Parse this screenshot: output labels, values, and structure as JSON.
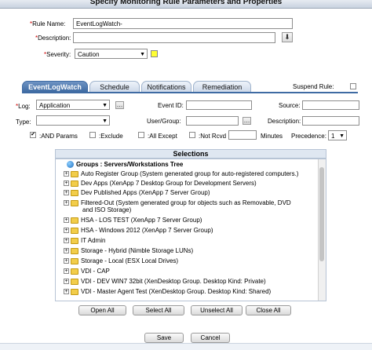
{
  "window": {
    "title": "Specify Monitoring Rule Parameters and Properties"
  },
  "form": {
    "rule_name": {
      "label": "Rule Name:",
      "value": "EventLogWatch-"
    },
    "description": {
      "label": "Description:",
      "value": ""
    },
    "severity": {
      "label": "Severity:",
      "value": "Caution",
      "color": "#ffff33"
    }
  },
  "tabs": [
    {
      "label": "EventLogWatch",
      "active": true
    },
    {
      "label": "Schedule",
      "active": false
    },
    {
      "label": "Notifications",
      "active": false
    },
    {
      "label": "Remediation",
      "active": false
    }
  ],
  "suspend_rule": {
    "label": "Suspend Rule:",
    "checked": false
  },
  "eventlog": {
    "log": {
      "label": "Log:",
      "value": "Application"
    },
    "type": {
      "label": "Type:",
      "value": ""
    },
    "event_id": {
      "label": "Event ID:",
      "value": ""
    },
    "source": {
      "label": "Source:",
      "value": ""
    },
    "user_group": {
      "label": "User/Group:",
      "value": ""
    },
    "description": {
      "label": "Description:",
      "value": ""
    },
    "and_params": {
      "label": ":AND Params",
      "checked": true
    },
    "exclude": {
      "label": ":Exclude",
      "checked": false
    },
    "all_except": {
      "label": ":All Except",
      "checked": false
    },
    "not_rcvd_in": {
      "label": ":Not Rcvd In",
      "checked": false,
      "value": ""
    },
    "minutes_label": "Minutes",
    "precedence": {
      "label": "Precedence:",
      "value": "1"
    }
  },
  "selections": {
    "title": "Selections",
    "root": "Groups : Servers/Workstations Tree",
    "items": [
      "Auto Register Group (System generated group for auto-registered computers.)",
      "Dev Apps (XenApp 7 Desktop Group for Development Servers)",
      "Dev Published Apps (XenApp 7 Server Group)",
      "Filtered-Out (System generated group for objects such as Removable, DVD",
      "and ISO Storage)",
      "HSA - LOS TEST (XenApp 7 Server Group)",
      "HSA - Windows 2012 (XenApp 7 Server Group)",
      "IT Admin",
      "Storage - Hybrid (Nimble Storage LUNs)",
      "Storage - Local (ESX Local Drives)",
      "VDI - CAP",
      "VDI - DEV WIN7 32bit (XenDesktop Group. Desktop Kind: Private)",
      "VDI - Master Agent Test (XenDesktop Group. Desktop Kind: Shared)"
    ]
  },
  "buttons": {
    "open_all": "Open All",
    "select_all": "Select All",
    "unselect_all": "Unselect All",
    "close_all": "Close All",
    "save": "Save",
    "cancel": "Cancel"
  },
  "icons": {
    "lookup": "…",
    "dropdown": "▼",
    "check": "✔"
  }
}
